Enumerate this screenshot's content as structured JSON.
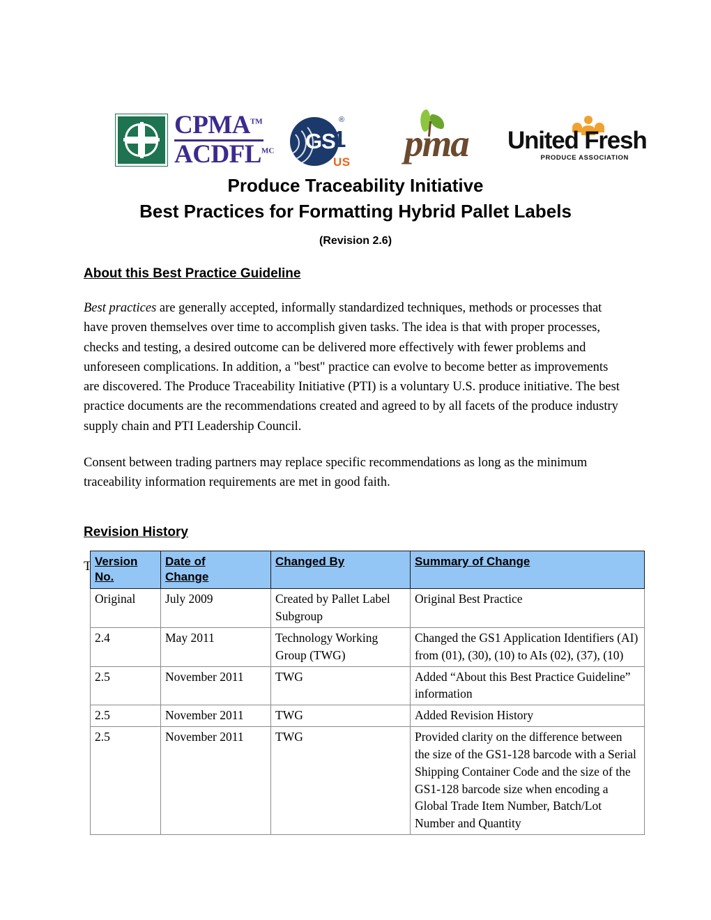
{
  "logos": [
    {
      "name": "cpma-acdfl-logo",
      "line1": "CPMA",
      "tm1": "TM",
      "line2": "ACDFL",
      "tm2": "MC",
      "mark_color": "#1e7350",
      "text_color": "#3b2b8f"
    },
    {
      "name": "gs1-us-logo",
      "text": "GS",
      "numeral": "1",
      "registered": "®",
      "region": "US",
      "circle_color": "#1b3a6b",
      "region_color": "#e8641c"
    },
    {
      "name": "pma-logo",
      "text": "pma",
      "text_color": "#6b4a2f",
      "leaf_color": "#8cc63f"
    },
    {
      "name": "united-fresh-logo",
      "name_text": "United Fresh",
      "subtitle": "PRODUCE ASSOCIATION",
      "accent_color": "#f0a12e"
    }
  ],
  "document": {
    "title_line1": "Produce Traceability Initiative",
    "title_line2": "Best Practices for Formatting Hybrid Pallet Labels",
    "revision": "(Revision 2.6)"
  },
  "sections": {
    "about": {
      "heading": "About this Best Practice Guideline",
      "paragraph1_lead": "Best practices",
      "paragraph1_rest": " are generally accepted, informally standardized techniques, methods or processes that have proven themselves over time to accomplish given tasks.  The idea is that with proper processes, checks and testing, a desired outcome can be delivered more effectively with fewer problems and unforeseen complications.  In addition, a \"best\" practice can evolve to become better as improvements are discovered.  The Produce Traceability Initiative (PTI) is a voluntary U.S. produce initiative. The best practice documents are the recommendations created and agreed to by all facets of the produce industry supply chain and PTI Leadership Council.",
      "paragraph2": "Consent between trading partners may replace specific recommendations as long as the minimum traceability information requirements are met in good faith."
    },
    "revision_history": {
      "heading": "Revision History",
      "intro": "This section itemizes the changes from the last published Best Practice."
    }
  },
  "revision_table": {
    "header_bg": "#93c5f5",
    "columns": [
      "Version No.",
      "Date of Change",
      "Changed By",
      "Summary of Change"
    ],
    "columns_display": [
      {
        "line1": "Version",
        "line2": "No."
      },
      {
        "line1": "Date of",
        "line2": "Change"
      },
      {
        "line1": "Changed By",
        "line2": ""
      },
      {
        "line1": "Summary of Change",
        "line2": ""
      }
    ],
    "rows": [
      {
        "version": "Original",
        "date": "July 2009",
        "changed_by": "Created by Pallet Label Subgroup",
        "summary": "Original Best Practice"
      },
      {
        "version": "2.4",
        "date": "May 2011",
        "changed_by": "Technology Working Group (TWG)",
        "summary": "Changed the GS1 Application Identifiers (AI) from (01), (30), (10) to AIs (02), (37), (10)"
      },
      {
        "version": "2.5",
        "date": "November 2011",
        "changed_by": "TWG",
        "summary": "Added “About this Best Practice Guideline” information"
      },
      {
        "version": "2.5",
        "date": "November 2011",
        "changed_by": "TWG",
        "summary": "Added Revision History"
      },
      {
        "version": "2.5",
        "date": "November 2011",
        "changed_by": "TWG",
        "summary": "Provided clarity on the difference between the size of the GS1-128 barcode with a Serial Shipping Container Code and the size of the GS1-128 barcode size when encoding a Global Trade Item Number, Batch/Lot Number and Quantity"
      }
    ]
  }
}
